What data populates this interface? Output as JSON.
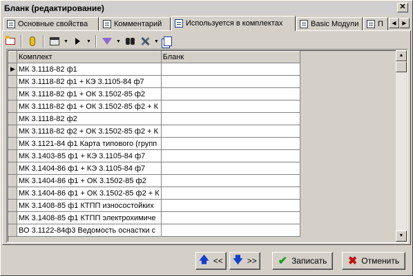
{
  "window": {
    "title": "Бланк (редактирование)",
    "close_glyph": "✕"
  },
  "tabs": [
    {
      "label": "Основные свойства",
      "active": false
    },
    {
      "label": "Комментарий",
      "active": false
    },
    {
      "label": "Используется в комплектах",
      "active": true
    },
    {
      "label": "Basic Модули",
      "active": false
    },
    {
      "label": "П",
      "active": false
    }
  ],
  "tab_scroll": {
    "left_glyph": "◀",
    "right_glyph": "▶"
  },
  "toolbar": {
    "icons": [
      "new-row-icon",
      "find-icon",
      "print-icon",
      "run-icon",
      "filter-icon",
      "binoculars-icon",
      "tools-icon",
      "copy-icon"
    ],
    "drop_glyph": "▼"
  },
  "grid": {
    "columns": [
      "Комплект",
      "Бланк"
    ],
    "current_row_glyph": "▶",
    "rows": [
      [
        "МК 3.1118-82 ф1",
        ""
      ],
      [
        "МК 3.1118-82 ф1 + КЭ 3.1105-84 ф7",
        ""
      ],
      [
        "МК 3.1118-82 ф1 + ОК 3.1502-85 ф2",
        ""
      ],
      [
        "МК 3.1118-82 ф1 + ОК 3.1502-85 ф2 + К",
        ""
      ],
      [
        "МК 3.1118-82 ф2",
        ""
      ],
      [
        "МК 3.1118-82 ф2 + ОК 3.1502-85 ф2 + К",
        ""
      ],
      [
        "МК 3.1121-84 ф1 Карта типового (групп",
        ""
      ],
      [
        "МК 3.1403-85 ф1 + КЭ 3.1105-84 ф7",
        ""
      ],
      [
        "МК 3.1404-86 ф1 + КЭ 3.1105-84 ф7",
        ""
      ],
      [
        "МК 3.1404-86 ф1 + ОК 3.1502-85 ф2",
        ""
      ],
      [
        "МК 3.1404-86 ф1 + ОК 3.1502-85 ф2 + К",
        ""
      ],
      [
        "МК 3.1408-85 ф1 КТПП износостойких",
        ""
      ],
      [
        "МК 3.1408-85 ф1 КТПП электрохимиче",
        ""
      ],
      [
        "ВО 3.1122-84ф3 Ведомость оснастки с",
        ""
      ]
    ]
  },
  "scrollbar": {
    "up_glyph": "▲",
    "down_glyph": "▼"
  },
  "footer": {
    "prev_label": "<<",
    "next_label": ">>",
    "save_label": "Записать",
    "cancel_label": "Отменить",
    "up_glyph": "🡅",
    "down_glyph": "🡇",
    "check_glyph": "✔",
    "x_glyph": "✖"
  }
}
